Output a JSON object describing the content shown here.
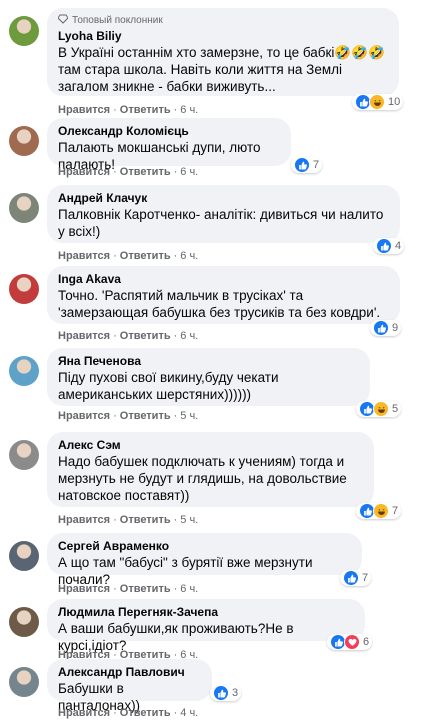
{
  "colors": {
    "like": "#1877f2",
    "haha": "#f7b928",
    "love": "#f33e58",
    "bubble": "#f0f2f5"
  },
  "labels": {
    "like": "Нравится",
    "reply": "Ответить",
    "sep": "·"
  },
  "comments": [
    {
      "badge": "Топовый поклонник",
      "author": "Lyoha Biliy",
      "text": "В Україні останнім хто замерзне, то це бабкі🤣🤣🤣 там стара школа. Навіть коли життя на Землі загалом зникне - бабки виживуть...",
      "time": "6 ч.",
      "reactions": [
        "like-icon",
        "haha-icon"
      ],
      "count": "10"
    },
    {
      "author": "Олександр Коломієць",
      "text": "Палають мокшанські дупи, люто палають!",
      "time": "6 ч.",
      "reactions": [
        "like-icon"
      ],
      "count": "7"
    },
    {
      "author": "Андрей Клачук",
      "text": "Палковнік Каротченко- аналітік: дивиться чи налито у всіх!)",
      "time": "6 ч.",
      "reactions": [
        "like-icon"
      ],
      "count": "4"
    },
    {
      "author": "Inga Akava",
      "text": "Точно. 'Распятий мальчик в трусіках' та 'замерзающая бабушка без трусиків та без ковдри'.",
      "time": "6 ч.",
      "reactions": [
        "like-icon"
      ],
      "count": "9"
    },
    {
      "author": "Яна Печенова",
      "text": "Піду пухові свої викину,буду чекати американських шерстяних))))))",
      "time": "5 ч.",
      "reactions": [
        "like-icon",
        "haha-icon"
      ],
      "count": "5"
    },
    {
      "author": "Алекс Сэм",
      "text": "Надо бабушек подключать к учениям) тогда и мерзнуть не будут и глядишь, на довольствие натовское поставят))",
      "time": "5 ч.",
      "reactions": [
        "like-icon",
        "haha-icon"
      ],
      "count": "7"
    },
    {
      "author": "Сергей Авраменко",
      "text": "А що там \"бабусі\" з бурятії вже мерзнути почали?",
      "time": "6 ч.",
      "reactions": [
        "like-icon"
      ],
      "count": "7"
    },
    {
      "author": "Людмила Перегняк-Зачепа",
      "text": "А ваши бабушки,як проживають?Не в курсі,ідіот?",
      "time": "6 ч.",
      "reactions": [
        "like-icon",
        "love-icon"
      ],
      "count": "6"
    },
    {
      "author": "Александр Павлович",
      "text": "Бабушки в панталонах))",
      "time": "4 ч.",
      "reactions": [
        "like-icon"
      ],
      "count": "3"
    }
  ]
}
